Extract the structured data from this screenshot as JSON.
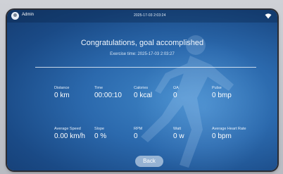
{
  "status_bar": {
    "username": "Admin",
    "datetime": "2025-17-03 2:03:24",
    "wifi_icon": "wifi-icon",
    "avatar_icon": "user-avatar-icon"
  },
  "result": {
    "title": "Congratulations, goal accomplished",
    "exercise_time": "Exercise time: 2025-17-03 2:03:27"
  },
  "stats_row1": [
    {
      "label": "Distance",
      "value": "0 km"
    },
    {
      "label": "Time",
      "value": "00:00:10"
    },
    {
      "label": "Calories",
      "value": "0 kcal"
    },
    {
      "label": "ΩA",
      "value": "0"
    },
    {
      "label": "Pulse",
      "value": "0 bmp"
    }
  ],
  "stats_row2": [
    {
      "label": "Average Speed",
      "value": "0.00 km/h"
    },
    {
      "label": "Slope",
      "value": "0 %"
    },
    {
      "label": "RPM",
      "value": "0"
    },
    {
      "label": "Watt",
      "value": "0 w"
    },
    {
      "label": "Average Heart Rate",
      "value": "0 bpm"
    }
  ],
  "actions": {
    "back_label": "Back"
  },
  "colors": {
    "screen_background": "#2b69ad",
    "text": "#ffffff",
    "button": "#c9d8e8"
  }
}
